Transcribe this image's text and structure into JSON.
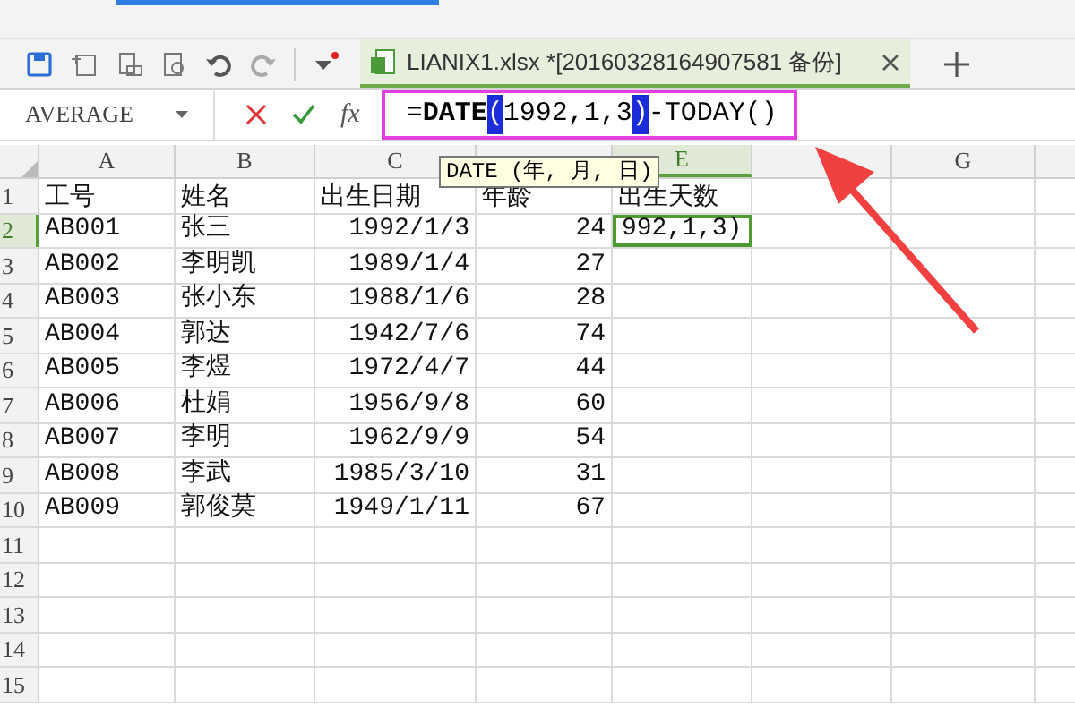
{
  "toolbar": {
    "tab": {
      "title": "LIANIX1.xlsx *[20160328164907581 备份]",
      "selected": true
    }
  },
  "formula_bar": {
    "name_box": "AVERAGE",
    "function_button": "fx",
    "formula": [
      {
        "text": "=",
        "kind": "plain"
      },
      {
        "text": "DATE",
        "kind": "function"
      },
      {
        "text": "(",
        "kind": "highlight"
      },
      {
        "text": "1992,1,3",
        "kind": "plain"
      },
      {
        "text": ")",
        "kind": "highlight"
      },
      {
        "text": "-TODAY()",
        "kind": "plain"
      }
    ]
  },
  "tooltip": "DATE (年, 月, 日)",
  "columns": [
    {
      "letter": "A",
      "selected": false
    },
    {
      "letter": "B",
      "selected": false
    },
    {
      "letter": "C",
      "selected": false
    },
    null,
    {
      "letter": "E",
      "selected": true
    },
    null,
    {
      "letter": "G",
      "selected": false
    }
  ],
  "rows": [
    {
      "number": "1",
      "selected": false,
      "kind": "header",
      "cells": [
        "工号",
        "姓名",
        "出生日期",
        "年龄",
        "出生天数"
      ]
    },
    {
      "number": "2",
      "selected": true,
      "kind": "data",
      "cells": [
        "AB001",
        "张三",
        "1992/1/3",
        "24",
        "992,1,3)"
      ]
    },
    {
      "number": "3",
      "selected": false,
      "kind": "data",
      "cells": [
        "AB002",
        "李明凯",
        "1989/1/4",
        "27"
      ]
    },
    {
      "number": "4",
      "selected": false,
      "kind": "data",
      "cells": [
        "AB003",
        "张小东",
        "1988/1/6",
        "28"
      ]
    },
    {
      "number": "5",
      "selected": false,
      "kind": "data",
      "cells": [
        "AB004",
        "郭达",
        "1942/7/6",
        "74"
      ]
    },
    {
      "number": "6",
      "selected": false,
      "kind": "data",
      "cells": [
        "AB005",
        "李煜",
        "1972/4/7",
        "44"
      ]
    },
    {
      "number": "7",
      "selected": false,
      "kind": "data",
      "cells": [
        "AB006",
        "杜娟",
        "1956/9/8",
        "60"
      ]
    },
    {
      "number": "8",
      "selected": false,
      "kind": "data",
      "cells": [
        "AB007",
        "李明",
        "1962/9/9",
        "54"
      ]
    },
    {
      "number": "9",
      "selected": false,
      "kind": "data",
      "cells": [
        "AB008",
        "李武",
        "1985/3/10",
        "31"
      ]
    },
    {
      "number": "10",
      "selected": false,
      "kind": "data",
      "cells": [
        "AB009",
        "郭俊莫",
        "1949/1/11",
        "67"
      ]
    },
    {
      "number": "11",
      "selected": false,
      "kind": "data"
    },
    {
      "number": "12",
      "selected": false,
      "kind": "data"
    },
    {
      "number": "13",
      "selected": false,
      "kind": "data"
    },
    {
      "number": "14",
      "selected": false,
      "kind": "data"
    },
    {
      "number": "15",
      "selected": false,
      "kind": "data"
    }
  ]
}
